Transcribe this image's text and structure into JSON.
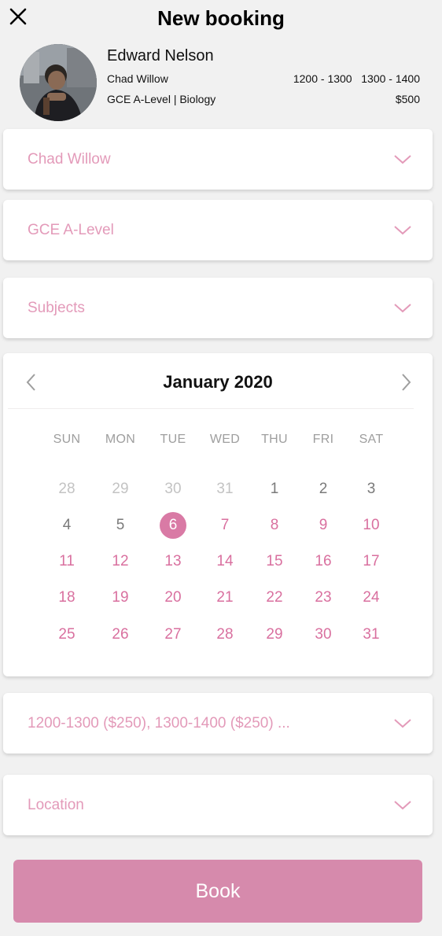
{
  "header": {
    "title": "New booking",
    "close_icon": "close-icon"
  },
  "tutor": {
    "name": "Edward Nelson",
    "student": "Chad Willow",
    "course": "GCE A-Level | Biology",
    "times": "1200 - 1300   1300 - 1400",
    "price": "$500"
  },
  "dropdowns": {
    "student": "Chad Willow",
    "level": "GCE A-Level",
    "subjects": "Subjects",
    "slots": "1200-1300 ($250), 1300-1400 ($250) ...",
    "location": "Location"
  },
  "calendar": {
    "month": "January 2020",
    "weekdays": [
      "SUN",
      "MON",
      "TUE",
      "WED",
      "THU",
      "FRI",
      "SAT"
    ],
    "weeks": [
      [
        "28",
        "29",
        "30",
        "31",
        "1",
        "2",
        "3"
      ],
      [
        "4",
        "5",
        "6",
        "7",
        "8",
        "9",
        "10"
      ],
      [
        "11",
        "12",
        "13",
        "14",
        "15",
        "16",
        "17"
      ],
      [
        "18",
        "19",
        "20",
        "21",
        "22",
        "23",
        "24"
      ],
      [
        "25",
        "26",
        "27",
        "28",
        "29",
        "30",
        "31"
      ]
    ],
    "selected_day": "6"
  },
  "actions": {
    "book_label": "Book"
  },
  "colors": {
    "accent": "#d68aac",
    "accent_light": "#e39ab9",
    "background": "#f1f1f1"
  }
}
